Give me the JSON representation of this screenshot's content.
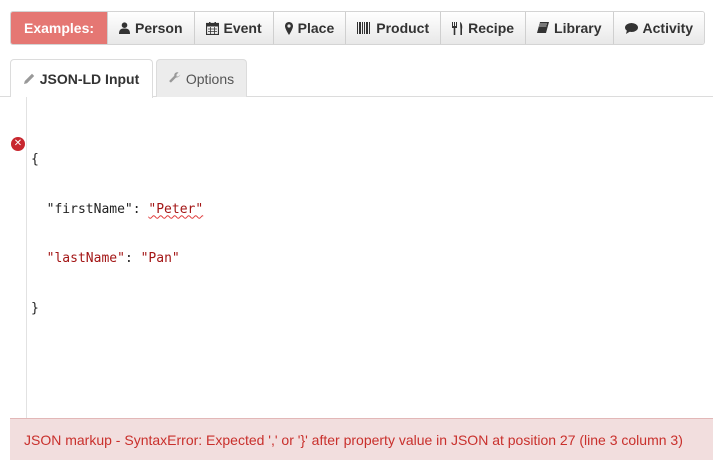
{
  "examples": {
    "label": "Examples:",
    "items": [
      {
        "label": "Person",
        "icon": "user-icon"
      },
      {
        "label": "Event",
        "icon": "calendar-icon"
      },
      {
        "label": "Place",
        "icon": "map-marker-icon"
      },
      {
        "label": "Product",
        "icon": "barcode-icon"
      },
      {
        "label": "Recipe",
        "icon": "cutlery-icon"
      },
      {
        "label": "Library",
        "icon": "book-icon"
      },
      {
        "label": "Activity",
        "icon": "comment-icon"
      }
    ],
    "label_color": "#e57773"
  },
  "tabs": [
    {
      "label": "JSON-LD Input",
      "icon": "pencil-icon",
      "active": true
    },
    {
      "label": "Options",
      "icon": "wrench-icon",
      "active": false
    }
  ],
  "editor": {
    "lines": [
      {
        "punct_open": "{"
      },
      {
        "key": "\"firstName\"",
        "sep": ": ",
        "value": "\"Peter\""
      },
      {
        "key": "\"lastName\"",
        "sep": ": ",
        "value": "\"Pan\""
      },
      {
        "punct_close": "}"
      }
    ],
    "error_marker_icon": "error-circle-icon"
  },
  "error": {
    "message": "JSON markup - SyntaxError: Expected ',' or '}' after property value in JSON at position 27 (line 3 column 3)",
    "color": "#c9302c"
  }
}
